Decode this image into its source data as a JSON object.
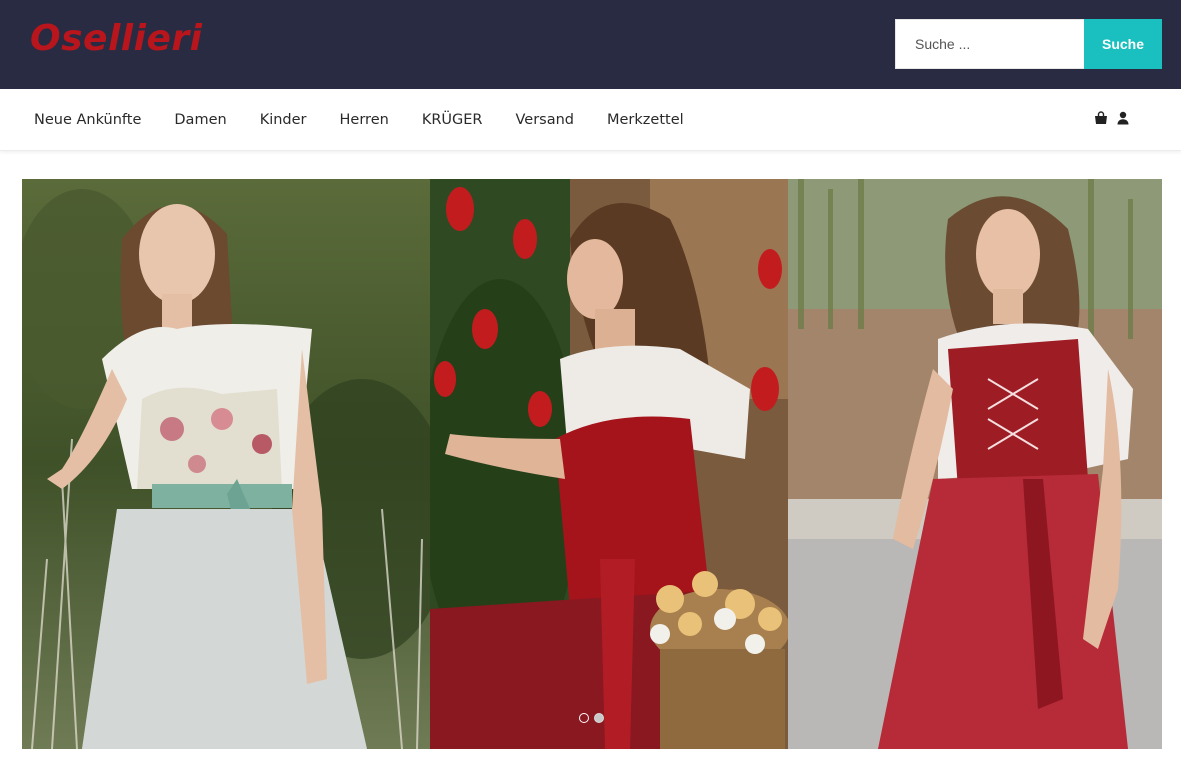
{
  "brand": {
    "name": "Osellieri",
    "color": "#b8151c"
  },
  "search": {
    "placeholder": "Suche ...",
    "button_label": "Suche",
    "button_color": "#1abfbf"
  },
  "header": {
    "background": "#292b42"
  },
  "nav": {
    "items": [
      {
        "label": "Neue Ankünfte"
      },
      {
        "label": "Damen"
      },
      {
        "label": "Kinder"
      },
      {
        "label": "Herren"
      },
      {
        "label": "KRÜGER"
      },
      {
        "label": "Versand"
      },
      {
        "label": "Merkzettel"
      }
    ],
    "icons": [
      "shopping-bag-icon",
      "user-icon"
    ]
  },
  "slider": {
    "slides": [
      {
        "subject": "white floral dirndl"
      },
      {
        "subject": "red dirndl with flower basket"
      },
      {
        "subject": "red lace dirndl"
      }
    ],
    "dot_count": 2,
    "active_dot": 2
  }
}
